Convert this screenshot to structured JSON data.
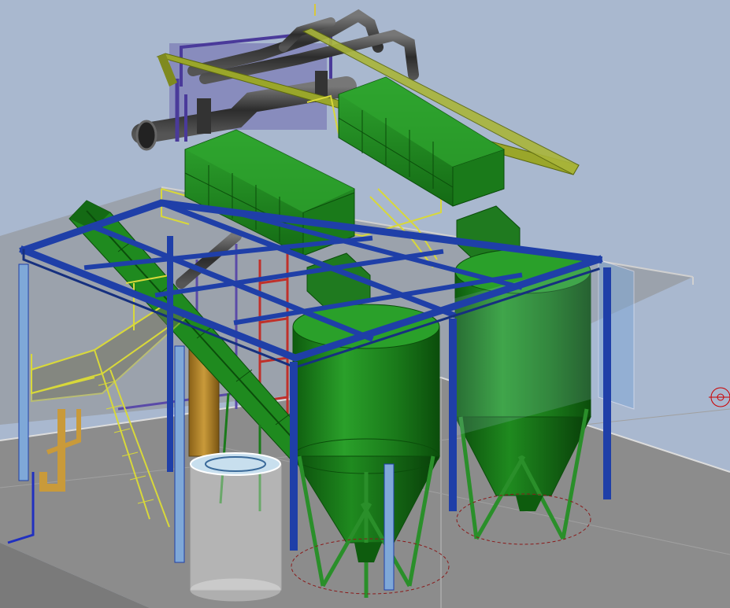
{
  "scene": {
    "colors": {
      "background": "#a9b8cf",
      "floor": "#8f8f8f",
      "floor_edge": "#d9d9d9",
      "blue_steel": "#1f3fa8",
      "light_blue_steel": "#7fa8d8",
      "green_equipment": "#1f8a1f",
      "green_dark": "#0b4d0b",
      "yellow_rail": "#d8d83a",
      "olive_beam": "#9aa62a",
      "red_frame": "#c0302a",
      "purple_frame": "#4a3a9a",
      "pipe_grey": "#3a3a3a",
      "orange_tank": "#b8862a"
    },
    "objects": [
      {
        "name": "floor-slab"
      },
      {
        "name": "blue-steel-frame"
      },
      {
        "name": "silo-left"
      },
      {
        "name": "silo-right"
      },
      {
        "name": "green-enclosure-left"
      },
      {
        "name": "green-enclosure-right"
      },
      {
        "name": "pipe-manifold"
      },
      {
        "name": "conveyor-belt"
      },
      {
        "name": "yellow-stairs"
      },
      {
        "name": "red-ladder-frame"
      },
      {
        "name": "purple-pipe-rack"
      },
      {
        "name": "orange-tank"
      },
      {
        "name": "transparent-tank"
      },
      {
        "name": "olive-crane-beam"
      }
    ]
  }
}
